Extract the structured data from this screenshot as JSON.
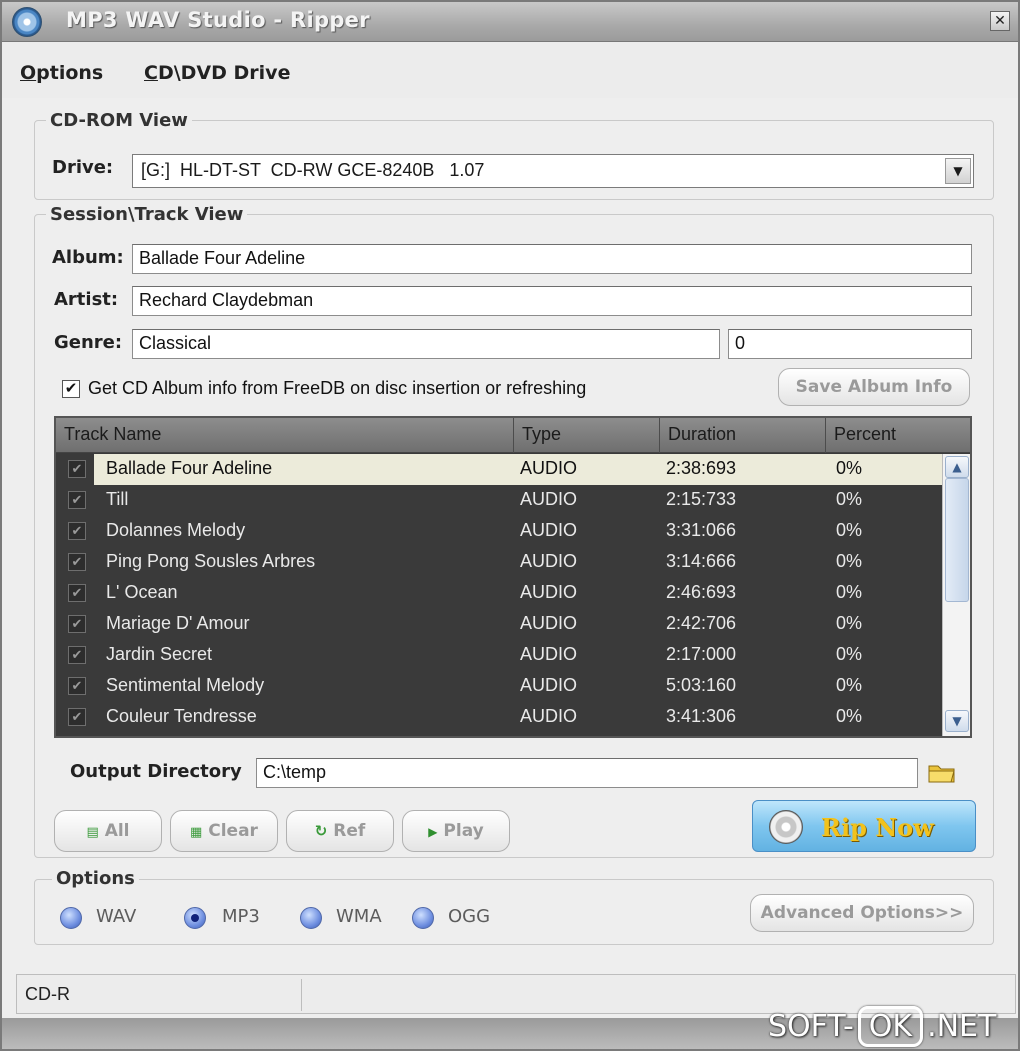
{
  "window": {
    "title": "MP3 WAV Studio - Ripper",
    "close_label": "✕"
  },
  "menu": [
    {
      "label": "Options",
      "accel": "O",
      "rest": "ptions"
    },
    {
      "label": "CD\\DVD Drive",
      "accel": "C",
      "rest": "D\\DVD Drive"
    }
  ],
  "cdrom": {
    "group_title": "CD-ROM View",
    "drive_label": "Drive:",
    "drive_value": "[G:]  HL-DT-ST  CD-RW GCE-8240B   1.07"
  },
  "session": {
    "group_title": "Session\\Track View",
    "album_label": "Album:",
    "album_value": "Ballade Four Adeline",
    "artist_label": "Artist:",
    "artist_value": "Rechard Claydebman",
    "genre_label": "Genre:",
    "genre_value": "Classical",
    "genre_extra": "0",
    "freedb_checked": true,
    "freedb_text": "Get CD Album info from FreeDB on disc insertion or refreshing",
    "save_button": "Save Album Info"
  },
  "tracks": {
    "columns": [
      "Track Name",
      "Type",
      "Duration",
      "Percent"
    ],
    "rows": [
      {
        "name": "Ballade Four Adeline",
        "type": "AUDIO",
        "duration": "2:38:693",
        "percent": "0%",
        "selected": true
      },
      {
        "name": "Till",
        "type": "AUDIO",
        "duration": "2:15:733",
        "percent": "0%"
      },
      {
        "name": "Dolannes Melody",
        "type": "AUDIO",
        "duration": "3:31:066",
        "percent": "0%"
      },
      {
        "name": "Ping Pong Sousles Arbres",
        "type": "AUDIO",
        "duration": "3:14:666",
        "percent": "0%"
      },
      {
        "name": "L' Ocean",
        "type": "AUDIO",
        "duration": "2:46:693",
        "percent": "0%"
      },
      {
        "name": "Mariage D' Amour",
        "type": "AUDIO",
        "duration": "2:42:706",
        "percent": "0%"
      },
      {
        "name": "Jardin Secret",
        "type": "AUDIO",
        "duration": "2:17:000",
        "percent": "0%"
      },
      {
        "name": "Sentimental Melody",
        "type": "AUDIO",
        "duration": "5:03:160",
        "percent": "0%"
      },
      {
        "name": "Couleur Tendresse",
        "type": "AUDIO",
        "duration": "3:41:306",
        "percent": "0%"
      }
    ]
  },
  "output": {
    "label": "Output Directory",
    "value": "C:\\temp"
  },
  "buttons": {
    "all": "All",
    "clear": "Clear",
    "ref": "Ref",
    "play": "Play",
    "rip_now": "Rip Now"
  },
  "options": {
    "group_title": "Options",
    "formats": [
      "WAV",
      "MP3",
      "WMA",
      "OGG"
    ],
    "selected_format": "MP3",
    "advanced_button": "Advanced Options>>"
  },
  "status": {
    "left": "CD-R"
  },
  "watermark": {
    "left": "SOFT-",
    "mid": "OK",
    "right": ".NET"
  }
}
